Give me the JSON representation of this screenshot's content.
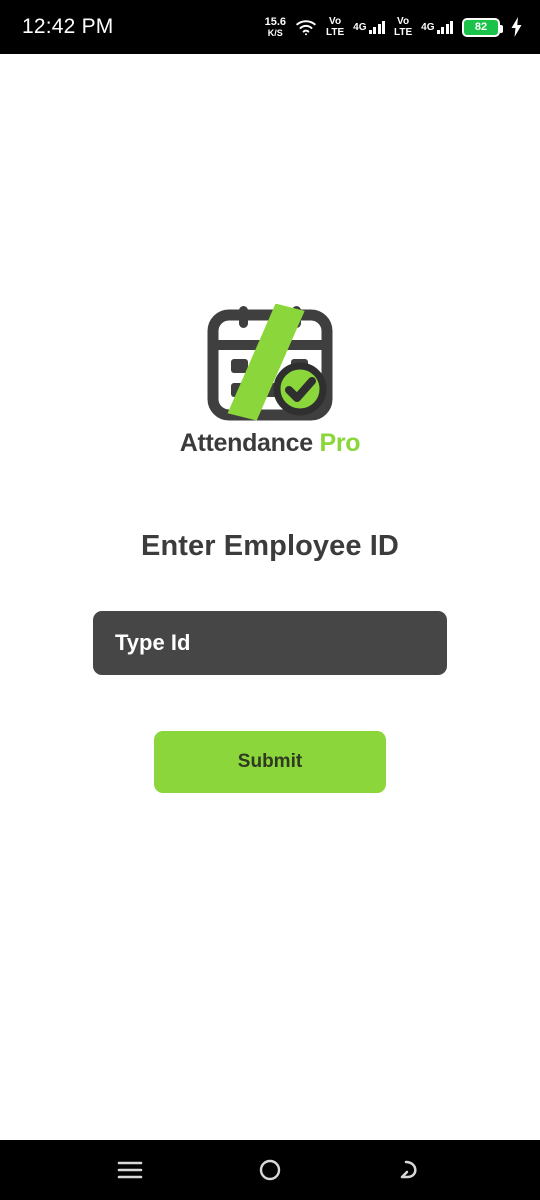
{
  "status_bar": {
    "time": "12:42 PM",
    "network_speed_value": "15.6",
    "network_speed_unit": "K/S",
    "wifi_icon": "wifi-icon",
    "sim1": {
      "volte_line1": "Vo",
      "volte_line2": "LTE",
      "network": "4G"
    },
    "sim2": {
      "volte_line1": "Vo",
      "volte_line2": "LTE",
      "network": "4G"
    },
    "battery_level": "82",
    "charging_icon": "charging-bolt-icon"
  },
  "app": {
    "logo": {
      "icon_name": "calendar-check-logo",
      "name_primary": "Attendance",
      "name_secondary": "Pro"
    },
    "heading": "Enter Employee ID",
    "employee_id_input": {
      "value": "",
      "placeholder": "Type Id"
    },
    "submit_label": "Submit"
  },
  "nav_bar": {
    "recents_label": "recents-icon",
    "home_label": "home-icon",
    "back_label": "back-icon"
  },
  "colors": {
    "brand_green": "#8BD63B",
    "input_dark": "#464646",
    "text_dark": "#3c3c3c",
    "battery_green": "#1bc24a",
    "system_black": "#000000"
  }
}
